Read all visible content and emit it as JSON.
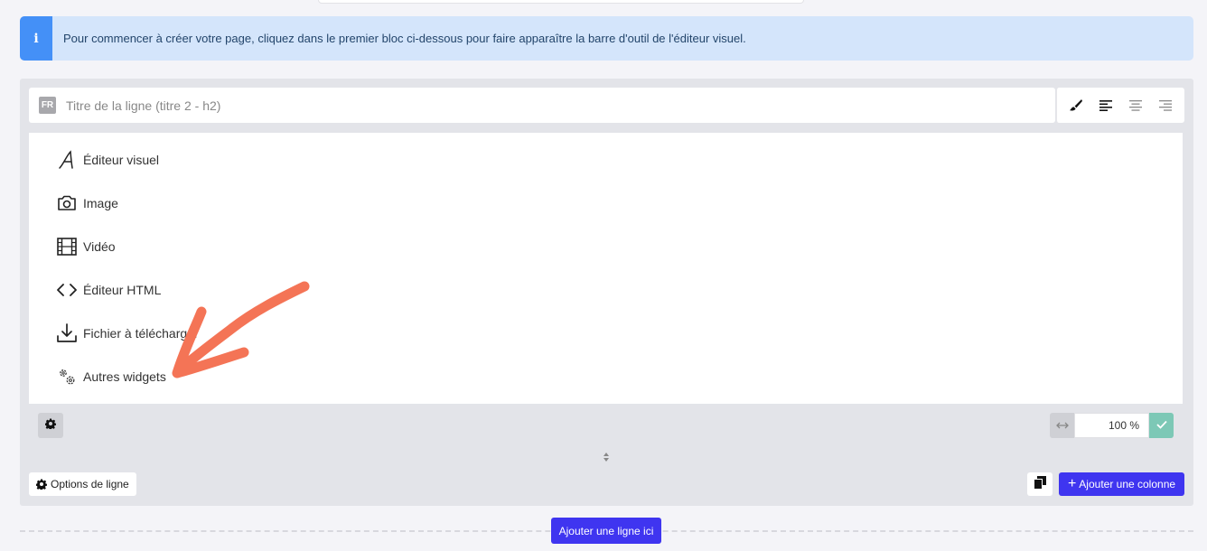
{
  "info_banner": {
    "icon": "i",
    "text": "Pour commencer à créer votre page, cliquez dans le premier bloc ci-dessous pour faire apparaître la barre d'outil de l'éditeur visuel."
  },
  "row": {
    "lang_badge": "FR",
    "title_placeholder": "Titre de la ligne (titre 2 - h2)",
    "toolbar_icons": [
      "paintbrush-icon",
      "align-left-icon",
      "align-center-icon",
      "align-right-icon"
    ],
    "widgets": [
      {
        "icon": "text-a-icon",
        "label": "Éditeur visuel"
      },
      {
        "icon": "camera-icon",
        "label": "Image"
      },
      {
        "icon": "film-icon",
        "label": "Vidéo"
      },
      {
        "icon": "code-icon",
        "label": "Éditeur HTML"
      },
      {
        "icon": "download-icon",
        "label": "Fichier à télécharger"
      },
      {
        "icon": "gears-icon",
        "label": "Autres widgets"
      }
    ],
    "column_width": "100 %",
    "row_options_label": "Options de ligne",
    "add_column_label": "Ajouter une colonne",
    "add_column_plus": "+"
  },
  "add_row_label": "Ajouter une ligne ici",
  "colors": {
    "accent": "#3f35f0",
    "info_bg": "#d4e5fb",
    "info_icon": "#4490f7",
    "confirm": "#7dc8b6",
    "annotation_arrow": "#f47456"
  }
}
